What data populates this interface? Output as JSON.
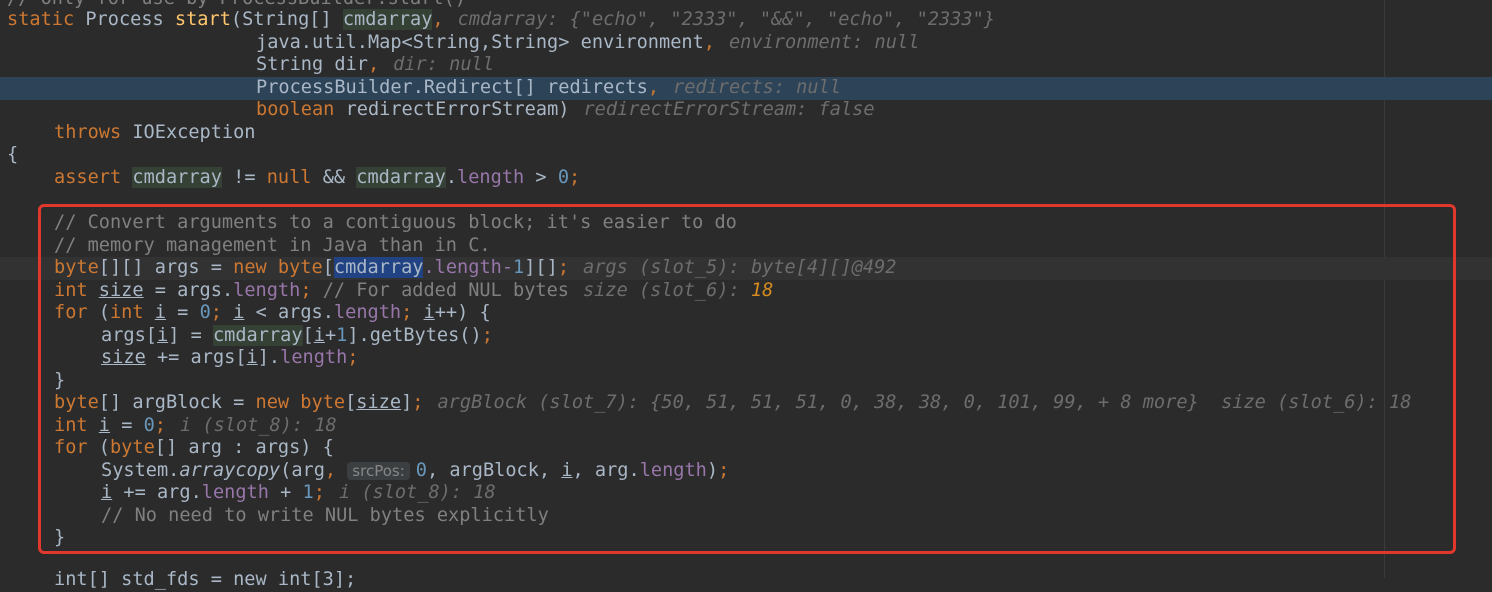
{
  "editor": {
    "language": "java",
    "colors": {
      "background": "#2b2b2b",
      "keyword": "#cc7832",
      "method": "#ffc66d",
      "number": "#6897bb",
      "comment": "#808080",
      "field": "#9876aa",
      "selection_line": "#2d4358",
      "annotation_box": "#e0382c"
    },
    "top_comment": "// Only for use by ProcessBuilder.start()",
    "sig": {
      "kw_static": "static",
      "ret": " Process ",
      "name": "start",
      "p1_type": "(String[] ",
      "p1_name": "cmdarray",
      "comma": ",",
      "p1_hint": "cmdarray: {\"echo\", \"2333\", \"&&\", \"echo\", \"2333\"}",
      "p2": "java.util.Map<String,String> environment",
      "p2_hint": "environment: null",
      "p3": "String dir",
      "p3_hint": "dir: null",
      "p4": "ProcessBuilder.Redirect[] redirects",
      "p4_hint": "redirects: null",
      "p5_kw": "boolean",
      "p5": " redirectErrorStream)",
      "p5_hint": "redirectErrorStream: false",
      "throws_kw": "throws",
      "throws_type": " IOException",
      "open_brace": "{"
    },
    "assert_line": {
      "kw": "assert",
      "var1": "cmdarray",
      "op1": " != ",
      "null_kw": "null",
      "op2": " && ",
      "var2": "cmdarray",
      "dot": ".",
      "field": "length",
      "op3": " > ",
      "num": "0",
      "semi": ";"
    },
    "box": {
      "c1": "// Convert arguments to a contiguous block; it's easier to do",
      "c2": "// memory management in Java than in C.",
      "args_decl": {
        "type": "byte",
        "t2": "[][] args = ",
        "new_kw": "new",
        "t3": " byte",
        "lb": "[",
        "var": "cmdarray",
        "field_text": ".length-",
        "num": "1",
        "rb": "][]",
        "semi": ";",
        "hint": "args (slot_5): byte[4][]@492"
      },
      "size_decl": {
        "kw": "int",
        "var": "size",
        "t2": " = args.",
        "field": "length",
        "semi": "; ",
        "cmt": "// For added NUL bytes",
        "hint_label": "size (slot_6): ",
        "hint_val": "18"
      },
      "for1": {
        "kw": "for",
        "t1": " (",
        "int_kw": "int",
        "i1": "i",
        "t2": " = ",
        "zero": "0",
        "semi1": ";",
        "i2": "i",
        "t3": " < args.",
        "field": "length",
        "semi2": ";",
        "i3": "i",
        "t4": "++) {"
      },
      "for1_body1": {
        "t1": "args[",
        "i": "i",
        "t2": "] = ",
        "var": "cmdarray",
        "t3": "[",
        "i2": "i",
        "plus": "+",
        "one": "1",
        "t4": "].getBytes()",
        "semi": ";"
      },
      "for1_body2": {
        "var": "size",
        "t1": " += args[",
        "i": "i",
        "t2": "].",
        "field": "length",
        "semi": ";"
      },
      "close1": "}",
      "argblock": {
        "type": "byte",
        "t1": "[] argBlock = ",
        "new_kw": "new",
        "t2": " byte",
        "lb": "[",
        "var": "size",
        "rb": "]",
        "semi": ";",
        "hint": "argBlock (slot_7): {50, 51, 51, 51, 0, 38, 38, 0, 101, 99, + 8 more}  size (slot_6): 18"
      },
      "int_i": {
        "kw": "int",
        "var": "i",
        "t1": " = ",
        "zero": "0",
        "semi": ";",
        "hint": "i (slot_8): 18"
      },
      "for2": {
        "kw": "for",
        "t1": " (",
        "type": "byte",
        "t2": "[] arg : args) {"
      },
      "arraycopy": {
        "t1": "System.",
        "method": "arraycopy",
        "t2": "(arg",
        "comma": ", ",
        "pill": "srcPos:",
        "zero": "0",
        "t3": ", argBlock",
        "t4": ", ",
        "i": "i",
        "t5": ", arg.",
        "field": "length",
        "t6": ")",
        "semi": ";"
      },
      "i_inc": {
        "var": "i",
        "t1": " += arg.",
        "field": "length",
        "t2": " + ",
        "one": "1",
        "semi": ";",
        "hint": "i (slot_8): 18"
      },
      "c3": "// No need to write NUL bytes explicitly",
      "close2": "}"
    },
    "bottom_partial": "int[] std_fds = new int[3];"
  }
}
